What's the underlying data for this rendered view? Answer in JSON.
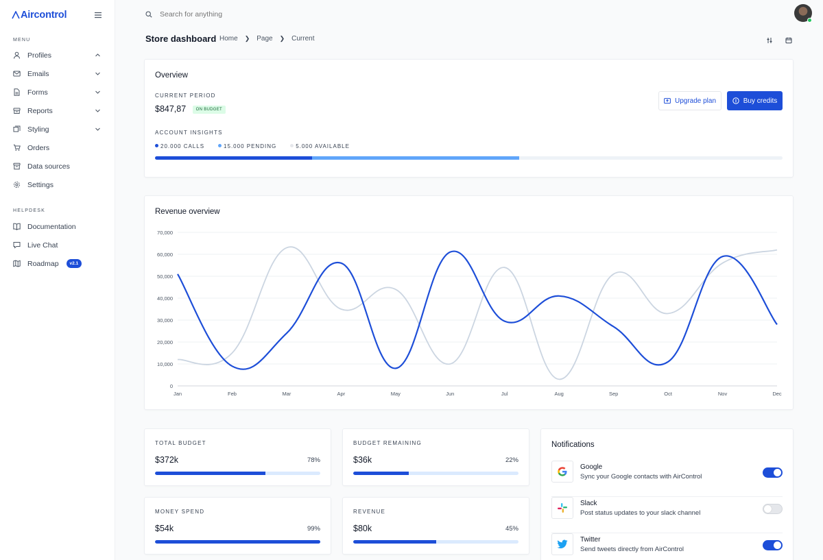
{
  "app": {
    "name": "Aircontrol"
  },
  "search": {
    "placeholder": "Search for anything"
  },
  "sidebar": {
    "menu_title": "MENU",
    "items": [
      {
        "label": "Profiles",
        "icon": "user-icon",
        "chevron": "up"
      },
      {
        "label": "Emails",
        "icon": "mail-icon",
        "chevron": "down"
      },
      {
        "label": "Forms",
        "icon": "document-icon",
        "chevron": "down"
      },
      {
        "label": "Reports",
        "icon": "archive-icon",
        "chevron": "down"
      },
      {
        "label": "Styling",
        "icon": "brush-icon",
        "chevron": "down"
      },
      {
        "label": "Orders",
        "icon": "cart-icon"
      },
      {
        "label": "Data sources",
        "icon": "database-icon"
      },
      {
        "label": "Settings",
        "icon": "gear-icon"
      }
    ],
    "helpdesk_title": "HELPDESK",
    "help_items": [
      {
        "label": "Documentation",
        "icon": "book-icon"
      },
      {
        "label": "Live Chat",
        "icon": "chat-icon"
      },
      {
        "label": "Roadmap",
        "icon": "map-icon",
        "badge": "v2.1"
      }
    ]
  },
  "header": {
    "title": "Store dashboard",
    "breadcrumb": [
      "Home",
      "Page",
      "Current"
    ]
  },
  "overview": {
    "title": "Overview",
    "period_label": "CURRENT PERIOD",
    "amount": "$847,87",
    "badge": "ON BUDGET",
    "upgrade_label": "Upgrade plan",
    "buy_label": "Buy credits",
    "insights_label": "ACCOUNT INSIGHTS",
    "legend": [
      {
        "label": "20.000 CALLS",
        "color": "#1d4ed8"
      },
      {
        "label": "15.000 PENDING",
        "color": "#60a5fa"
      },
      {
        "label": "5.000 AVAILABLE",
        "color": "#e5e7eb"
      }
    ],
    "bar_fractions": [
      0.25,
      0.33
    ]
  },
  "revenue": {
    "title": "Revenue overview"
  },
  "chart_data": {
    "type": "line",
    "categories": [
      "Jan",
      "Feb",
      "Mar",
      "Apr",
      "May",
      "Jun",
      "Jul",
      "Aug",
      "Sep",
      "Oct",
      "Nov",
      "Dec"
    ],
    "ylim": [
      0,
      70000
    ],
    "yticks": [
      "0",
      "10,000",
      "20,000",
      "30,000",
      "40,000",
      "50,000",
      "60,000",
      "70,000"
    ],
    "grid": true,
    "series": [
      {
        "values": [
          51000,
          9000,
          24000,
          56000,
          8000,
          61000,
          29500,
          41000,
          27000,
          11000,
          59000,
          28000
        ],
        "color": "#1d4ed8"
      },
      {
        "values": [
          12000,
          15000,
          63000,
          35000,
          44000,
          10000,
          54000,
          3000,
          51000,
          33000,
          56000,
          62000
        ],
        "color": "#cbd5e1"
      }
    ]
  },
  "stats": [
    {
      "label": "TOTAL BUDGET",
      "amount": "$372k",
      "pct": "78%",
      "fill": 0.667
    },
    {
      "label": "BUDGET REMAINING",
      "amount": "$36k",
      "pct": "22%",
      "fill": 0.335
    },
    {
      "label": "MONEY SPEND",
      "amount": "$54k",
      "pct": "99%",
      "fill": 1.0
    },
    {
      "label": "REVENUE",
      "amount": "$80k",
      "pct": "45%",
      "fill": 0.5
    }
  ],
  "notifications": {
    "title": "Notifications",
    "items": [
      {
        "name": "Google",
        "desc": "Sync your Google contacts with AirControl",
        "enabled": true
      },
      {
        "name": "Slack",
        "desc": "Post status updates to your slack channel",
        "enabled": false
      },
      {
        "name": "Twitter",
        "desc": "Send tweets directly from AirControl",
        "enabled": true
      }
    ]
  }
}
